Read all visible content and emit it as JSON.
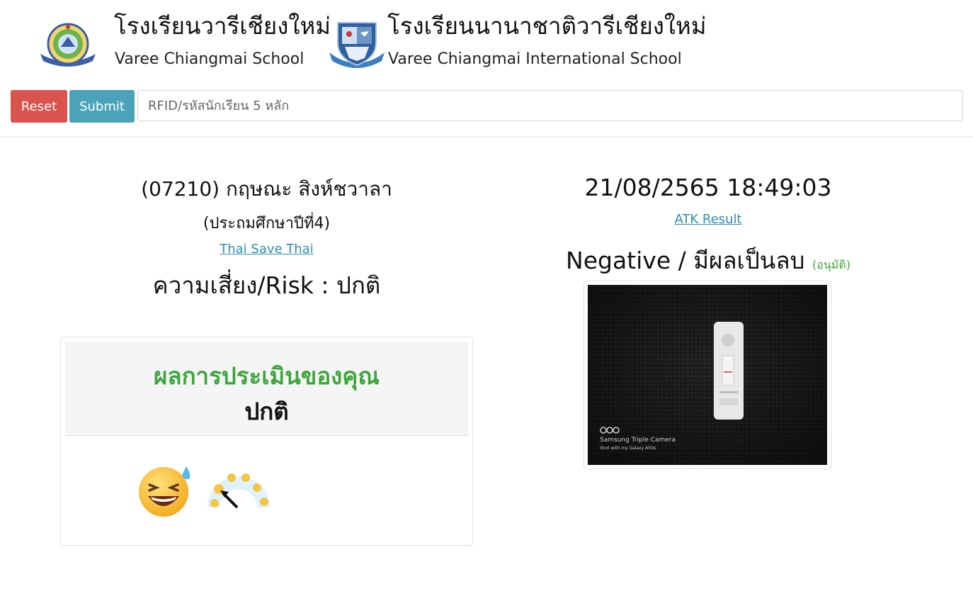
{
  "header": {
    "school1": {
      "name_th": "โรงเรียนวารีเชียงใหม่",
      "name_en": "Varee Chiangmai School",
      "logo_icon": "school-crest-icon"
    },
    "school2": {
      "name_th": "โรงเรียนนานาชาติวารีเชียงใหม่",
      "name_en": "Varee Chiangmai International School",
      "logo_icon": "shield-crest-icon"
    }
  },
  "toolbar": {
    "reset_label": "Reset",
    "submit_label": "Submit",
    "rfid_placeholder": "RFID/รหัสนักเรียน 5 หลัก",
    "reset_color": "#d9534f",
    "submit_color": "#4aa3b8"
  },
  "student": {
    "id_name": "(07210) กฤษณะ สิงห์ชวาลา",
    "grade": "(ประถมศึกษาปีที่4)",
    "tst_link": "Thai Save Thai",
    "risk": "ความเสี่ยง/Risk : ปกติ"
  },
  "assessment": {
    "title": "ผลการประเมินของคุณ",
    "value": "ปกติ",
    "title_color": "#3ea53e",
    "emoji_icon": "laughing-sweat-emoji-icon",
    "gauge_icon": "mood-gauge-icon"
  },
  "atk": {
    "datetime": "21/08/2565 18:49:03",
    "link": "ATK Result",
    "result": "Negative / มีผลเป็นลบ",
    "status": "(อนุมัติ)",
    "photo_caption": "Samsung Triple Camera",
    "photo_subcaption": "Shot with my Galaxy A50s",
    "link_color": "#2d8fb0"
  }
}
